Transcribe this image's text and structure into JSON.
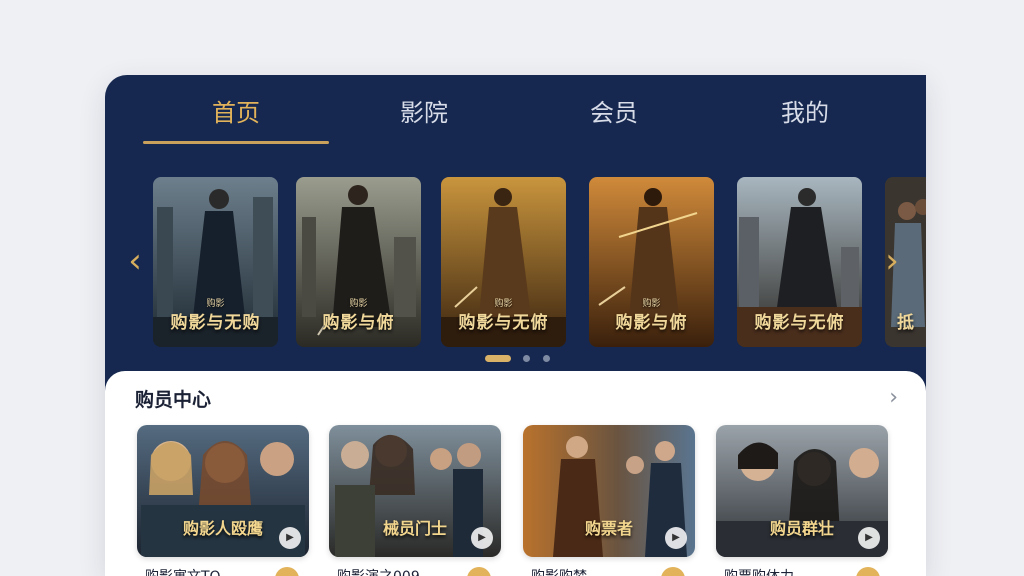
{
  "tabs": [
    {
      "label": "首页",
      "active": true
    },
    {
      "label": "影院",
      "active": false
    },
    {
      "label": "会员",
      "active": false
    },
    {
      "label": "我的",
      "active": false
    }
  ],
  "carousel": {
    "posters": [
      {
        "title": "购影与无购",
        "subtitle": "购影"
      },
      {
        "title": "购影与俯",
        "subtitle": "购影"
      },
      {
        "title": "购影与无俯",
        "subtitle": "购影"
      },
      {
        "title": "购影与俯",
        "subtitle": "购影"
      },
      {
        "title": "购影与无俯",
        "subtitle": ""
      },
      {
        "title": "抵",
        "subtitle": ""
      }
    ],
    "prev_icon": "chevron-left-icon",
    "next_icon": "chevron-right-icon",
    "page_count": 3,
    "active_page": 1
  },
  "section": {
    "title": "购员中心",
    "more_icon": "chevron-right-icon",
    "cards": [
      {
        "overlay": "购影人殴鹰",
        "caption": "购影寓文TQ"
      },
      {
        "overlay": "械员门士",
        "caption": "购影演之009"
      },
      {
        "overlay": "购票者",
        "caption": "购影购梦"
      },
      {
        "overlay": "购员群壮",
        "caption": "购票购体力"
      }
    ]
  },
  "colors": {
    "navy": "#16284f",
    "gold": "#e2b35a",
    "background": "#eff0f4"
  }
}
